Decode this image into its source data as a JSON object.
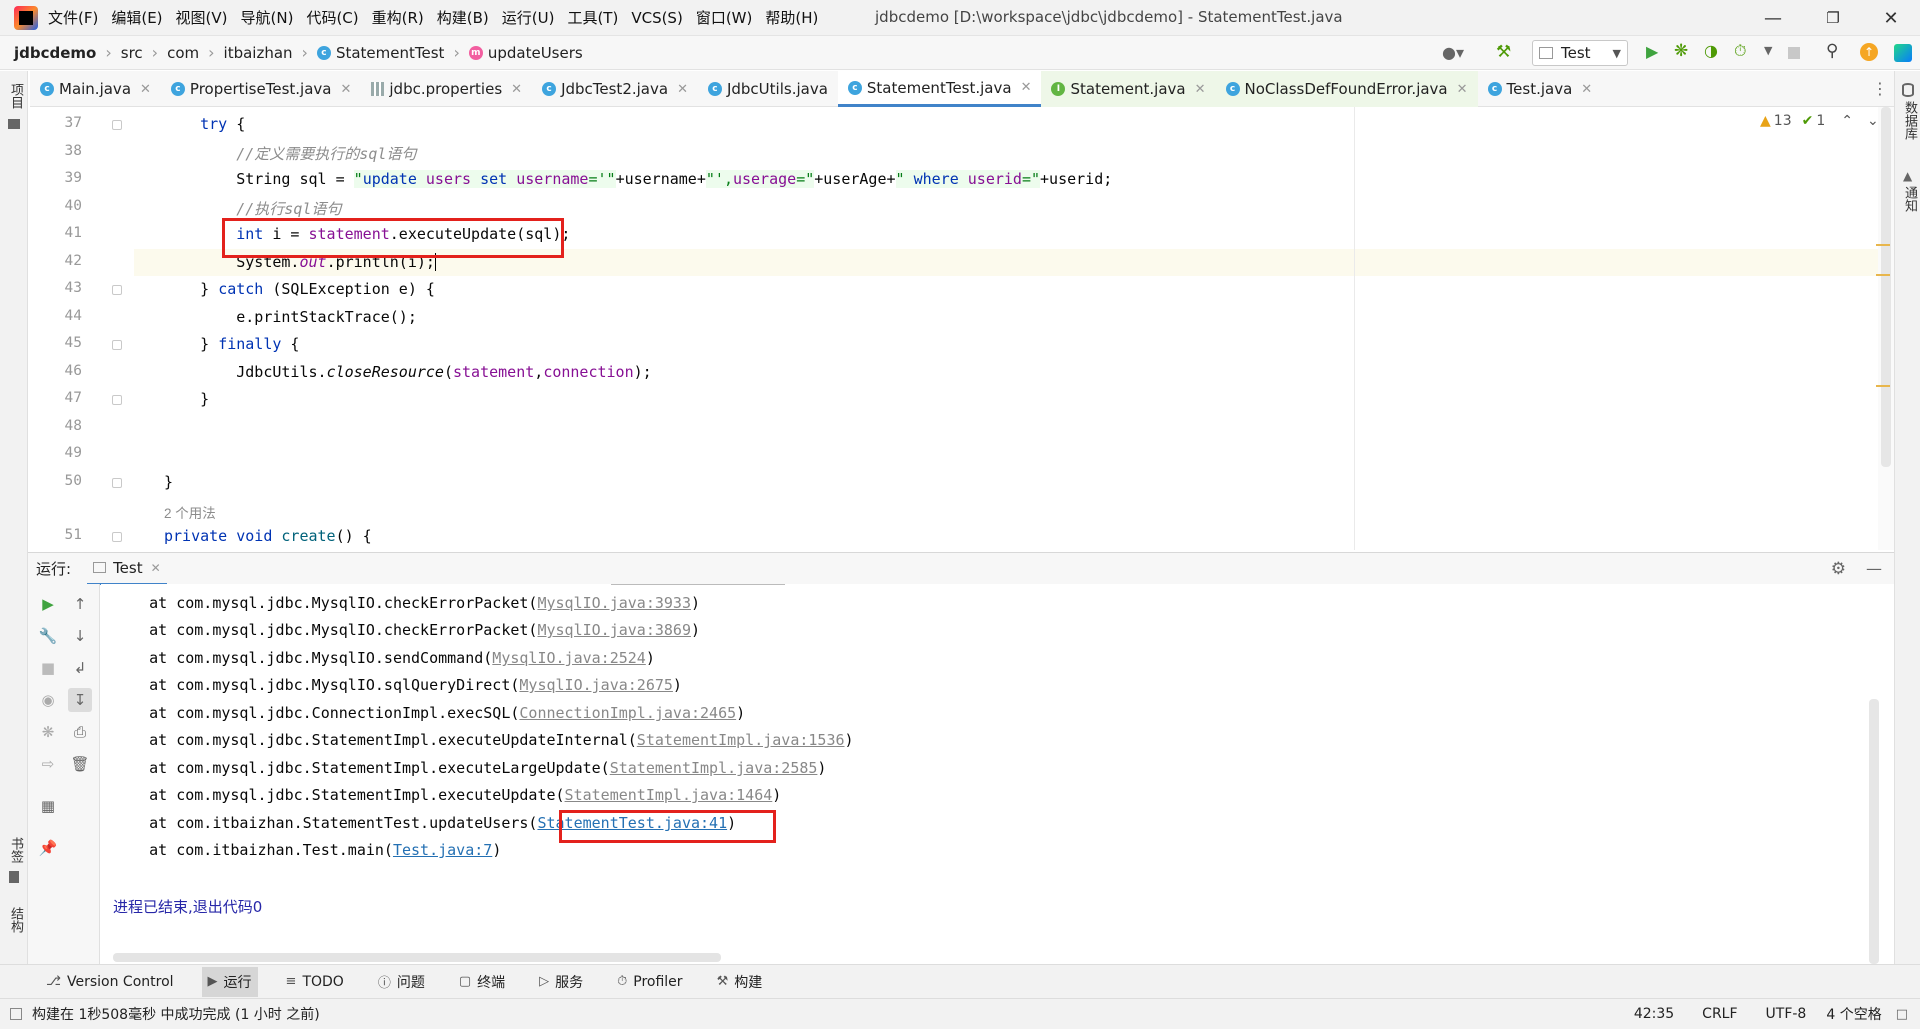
{
  "menu": [
    "文件(F)",
    "编辑(E)",
    "视图(V)",
    "导航(N)",
    "代码(C)",
    "重构(R)",
    "构建(B)",
    "运行(U)",
    "工具(T)",
    "VCS(S)",
    "窗口(W)",
    "帮助(H)"
  ],
  "window_title": "jdbcdemo [D:\\workspace\\jdbc\\jdbcdemo] - StatementTest.java",
  "breadcrumb": [
    "jdbcdemo",
    "src",
    "com",
    "itbaizhan",
    "StatementTest",
    "updateUsers"
  ],
  "run_config": "Test",
  "tabs": [
    {
      "label": "Main.java",
      "kind": "class"
    },
    {
      "label": "PropertiseTest.java",
      "kind": "class"
    },
    {
      "label": "jdbc.properties",
      "kind": "props"
    },
    {
      "label": "JdbcTest2.java",
      "kind": "class"
    },
    {
      "label": "JdbcUtils.java",
      "kind": "class"
    },
    {
      "label": "StatementTest.java",
      "kind": "class",
      "active": true
    },
    {
      "label": "Statement.java",
      "kind": "interface"
    },
    {
      "label": "NoClassDefFoundError.java",
      "kind": "class"
    },
    {
      "label": "Test.java",
      "kind": "class"
    }
  ],
  "left_strip": {
    "project": "项目",
    "bookmarks": "书签",
    "structure": "结构"
  },
  "right_strip": {
    "database": "数据库",
    "notifications": "通知"
  },
  "inspections": {
    "warnings": "13",
    "ok": "1"
  },
  "editor": {
    "line_numbers": [
      "37",
      "38",
      "39",
      "40",
      "41",
      "42",
      "43",
      "44",
      "45",
      "46",
      "47",
      "48",
      "49",
      "50",
      "",
      "51"
    ],
    "usage_hint": "2 个用法",
    "comment1": "//定义需要执行的sql语句",
    "comment2": "//执行sql语句"
  },
  "run_panel": {
    "label": "运行:",
    "tab": "Test",
    "stack": [
      {
        "text": "at com.mysql.jdbc.MysqlIO.checkErrorPacket(",
        "link": "MysqlIO.java:3933"
      },
      {
        "text": "at com.mysql.jdbc.MysqlIO.checkErrorPacket(",
        "link": "MysqlIO.java:3869"
      },
      {
        "text": "at com.mysql.jdbc.MysqlIO.sendCommand(",
        "link": "MysqlIO.java:2524"
      },
      {
        "text": "at com.mysql.jdbc.MysqlIO.sqlQueryDirect(",
        "link": "MysqlIO.java:2675"
      },
      {
        "text": "at com.mysql.jdbc.ConnectionImpl.execSQL(",
        "link": "ConnectionImpl.java:2465"
      },
      {
        "text": "at com.mysql.jdbc.StatementImpl.executeUpdateInternal(",
        "link": "StatementImpl.java:1536"
      },
      {
        "text": "at com.mysql.jdbc.StatementImpl.executeLargeUpdate(",
        "link": "StatementImpl.java:2585"
      },
      {
        "text": "at com.mysql.jdbc.StatementImpl.executeUpdate(",
        "link": "StatementImpl.java:1464"
      },
      {
        "text": "at com.itbaizhan.StatementTest.updateUsers(",
        "link": "StatementTest.java:41",
        "blue": true
      },
      {
        "text": "at com.itbaizhan.Test.main(",
        "link": "Test.java:7",
        "blue": true
      }
    ],
    "exit_message": "进程已结束,退出代码0"
  },
  "tool_windows": [
    "Version Control",
    "运行",
    "TODO",
    "问题",
    "终端",
    "服务",
    "Profiler",
    "构建"
  ],
  "status": {
    "message": "构建在 1秒508毫秒 中成功完成 (1 小时 之前)",
    "position": "42:35",
    "line_sep": "CRLF",
    "encoding": "UTF-8",
    "indent": "4 个空格"
  },
  "colors": {
    "highlight_box": "#e3211c",
    "active_tab": "#4083c9",
    "keyword": "#0033b3",
    "field": "#871094"
  }
}
